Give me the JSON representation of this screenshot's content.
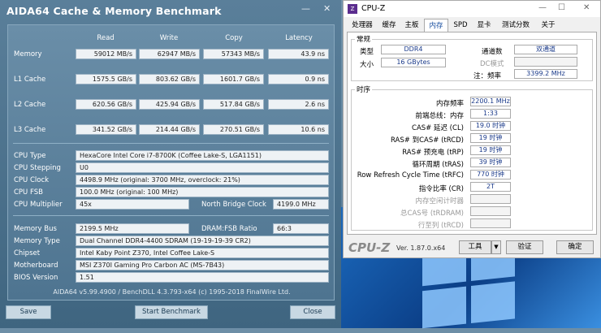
{
  "aida": {
    "title": "AIDA64 Cache & Memory Benchmark",
    "controls": {
      "minimize": "—",
      "close": "✕"
    },
    "headers": {
      "read": "Read",
      "write": "Write",
      "copy": "Copy",
      "latency": "Latency"
    },
    "bench_rows": [
      {
        "label": "Memory",
        "read": "59012 MB/s",
        "write": "62947 MB/s",
        "copy": "57343 MB/s",
        "latency": "43.9 ns"
      },
      {
        "label": "L1 Cache",
        "read": "1575.5 GB/s",
        "write": "803.62 GB/s",
        "copy": "1601.7 GB/s",
        "latency": "0.9 ns"
      },
      {
        "label": "L2 Cache",
        "read": "620.56 GB/s",
        "write": "425.94 GB/s",
        "copy": "517.84 GB/s",
        "latency": "2.6 ns"
      },
      {
        "label": "L3 Cache",
        "read": "341.52 GB/s",
        "write": "214.44 GB/s",
        "copy": "270.51 GB/s",
        "latency": "10.6 ns"
      }
    ],
    "cpu_type_label": "CPU Type",
    "cpu_type": "HexaCore Intel Core i7-8700K  (Coffee Lake-S, LGA1151)",
    "cpu_stepping_label": "CPU Stepping",
    "cpu_stepping": "U0",
    "cpu_clock_label": "CPU Clock",
    "cpu_clock": "4498.9 MHz  (original: 3700 MHz, overclock: 21%)",
    "cpu_fsb_label": "CPU FSB",
    "cpu_fsb": "100.0 MHz  (original: 100 MHz)",
    "cpu_mult_label": "CPU Multiplier",
    "cpu_mult": "45x",
    "nb_clock_label": "North Bridge Clock",
    "nb_clock": "4199.0 MHz",
    "mem_bus_label": "Memory Bus",
    "mem_bus": "2199.5 MHz",
    "dram_fsb_label": "DRAM:FSB Ratio",
    "dram_fsb": "66:3",
    "mem_type_label": "Memory Type",
    "mem_type": "Dual Channel DDR4-4400 SDRAM  (19-19-19-39 CR2)",
    "chipset_label": "Chipset",
    "chipset": "Intel Kaby Point Z370, Intel Coffee Lake-S",
    "mobo_label": "Motherboard",
    "mobo": "MSI Z370I Gaming Pro Carbon AC (MS-7B43)",
    "bios_label": "BIOS Version",
    "bios": "1.51",
    "footer": "AIDA64 v5.99.4900 / BenchDLL 4.3.793-x64  (c) 1995-2018 FinalWire Ltd.",
    "buttons": {
      "save": "Save",
      "start": "Start Benchmark",
      "close": "Close"
    }
  },
  "cpuz": {
    "title": "CPU-Z",
    "icon_text": "Z",
    "controls": {
      "minimize": "—",
      "maximize": "☐",
      "close": "✕"
    },
    "tabs": [
      "处理器",
      "缓存",
      "主板",
      "内存",
      "SPD",
      "显卡",
      "测试分数",
      "关于"
    ],
    "active_tab": "内存",
    "general": {
      "title": "常规",
      "type_label": "类型",
      "type": "DDR4",
      "size_label": "大小",
      "size": "16 GBytes",
      "channels_label": "通道数",
      "channels": "双通道",
      "dc_label": "DC模式",
      "dc": "",
      "nb_freq_label": "注：频率",
      "nb_freq": "3399.2 MHz"
    },
    "timings": {
      "title": "时序",
      "rows": [
        {
          "label": "内存频率",
          "value": "2200.1 MHz",
          "disabled": false
        },
        {
          "label": "前端总线：内存",
          "value": "1:33",
          "disabled": false
        },
        {
          "label": "CAS# 延迟 (CL)",
          "value": "19.0 时钟",
          "disabled": false
        },
        {
          "label": "RAS# 到CAS# (tRCD)",
          "value": "19 时钟",
          "disabled": false
        },
        {
          "label": "RAS# 预充电 (tRP)",
          "value": "19 时钟",
          "disabled": false
        },
        {
          "label": "循环周期 (tRAS)",
          "value": "39 时钟",
          "disabled": false
        },
        {
          "label": "Row Refresh Cycle Time (tRFC)",
          "value": "770 时钟",
          "disabled": false
        },
        {
          "label": "指令比率 (CR)",
          "value": "2T",
          "disabled": false
        },
        {
          "label": "内存空闲计时器",
          "value": "",
          "disabled": true
        },
        {
          "label": "总CAS号 (tRDRAM)",
          "value": "",
          "disabled": true
        },
        {
          "label": "行至列 (tRCD)",
          "value": "",
          "disabled": true
        }
      ]
    },
    "logo": "CPU-Z",
    "version": "Ver. 1.87.0.x64",
    "buttons": {
      "tools": "工具",
      "tools_arrow": "▼",
      "validate": "验证",
      "ok": "确定"
    }
  }
}
